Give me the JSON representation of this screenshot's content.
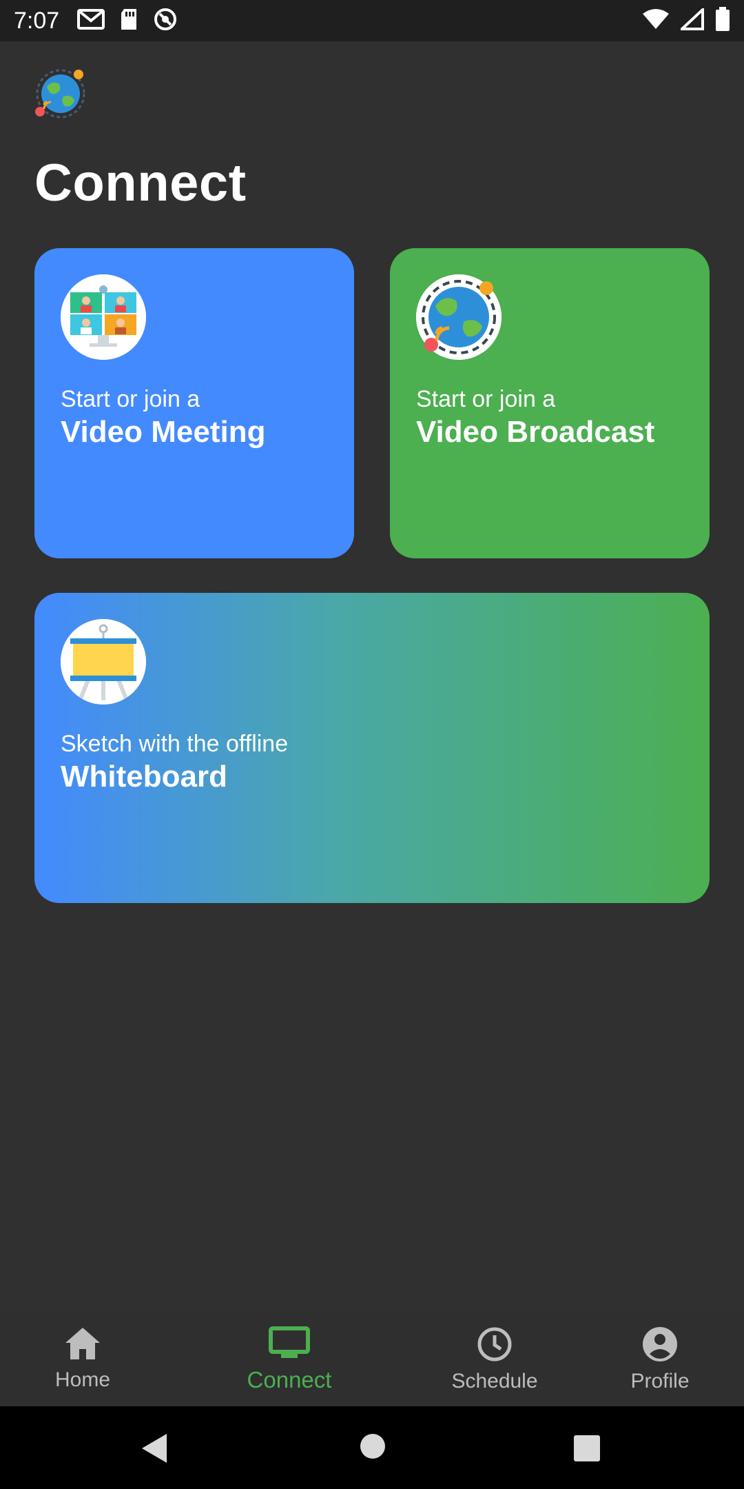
{
  "status_bar": {
    "time": "7:07",
    "icons_left": [
      "gmail-icon",
      "sd-card-icon",
      "blocked-icon"
    ],
    "icons_right": [
      "wifi-icon",
      "signal-icon",
      "battery-icon"
    ]
  },
  "header": {
    "logo_icon": "globe-broadcast-logo",
    "title": "Connect"
  },
  "cards": {
    "meeting": {
      "subtitle": "Start or join a",
      "title": "Video Meeting",
      "icon": "video-meeting-icon",
      "color": "#448AFF"
    },
    "broadcast": {
      "subtitle": "Start or join a",
      "title": "Video Broadcast",
      "icon": "globe-broadcast-icon",
      "color": "#4CAF50"
    },
    "whiteboard": {
      "subtitle": "Sketch with the offline",
      "title": "Whiteboard",
      "icon": "whiteboard-icon",
      "gradient": [
        "#448AFF",
        "#4CAF50"
      ]
    }
  },
  "bottom_nav": {
    "items": [
      {
        "label": "Home",
        "icon": "home-icon",
        "active": false
      },
      {
        "label": "Connect",
        "icon": "tv-icon",
        "active": true
      },
      {
        "label": "Schedule",
        "icon": "clock-icon",
        "active": false
      },
      {
        "label": "Profile",
        "icon": "account-circle-icon",
        "active": false
      }
    ],
    "active_color": "#4CAF50",
    "inactive_color": "#BDBDBD"
  },
  "system_nav": {
    "buttons": [
      "back-icon",
      "home-circle-icon",
      "recents-icon"
    ]
  }
}
